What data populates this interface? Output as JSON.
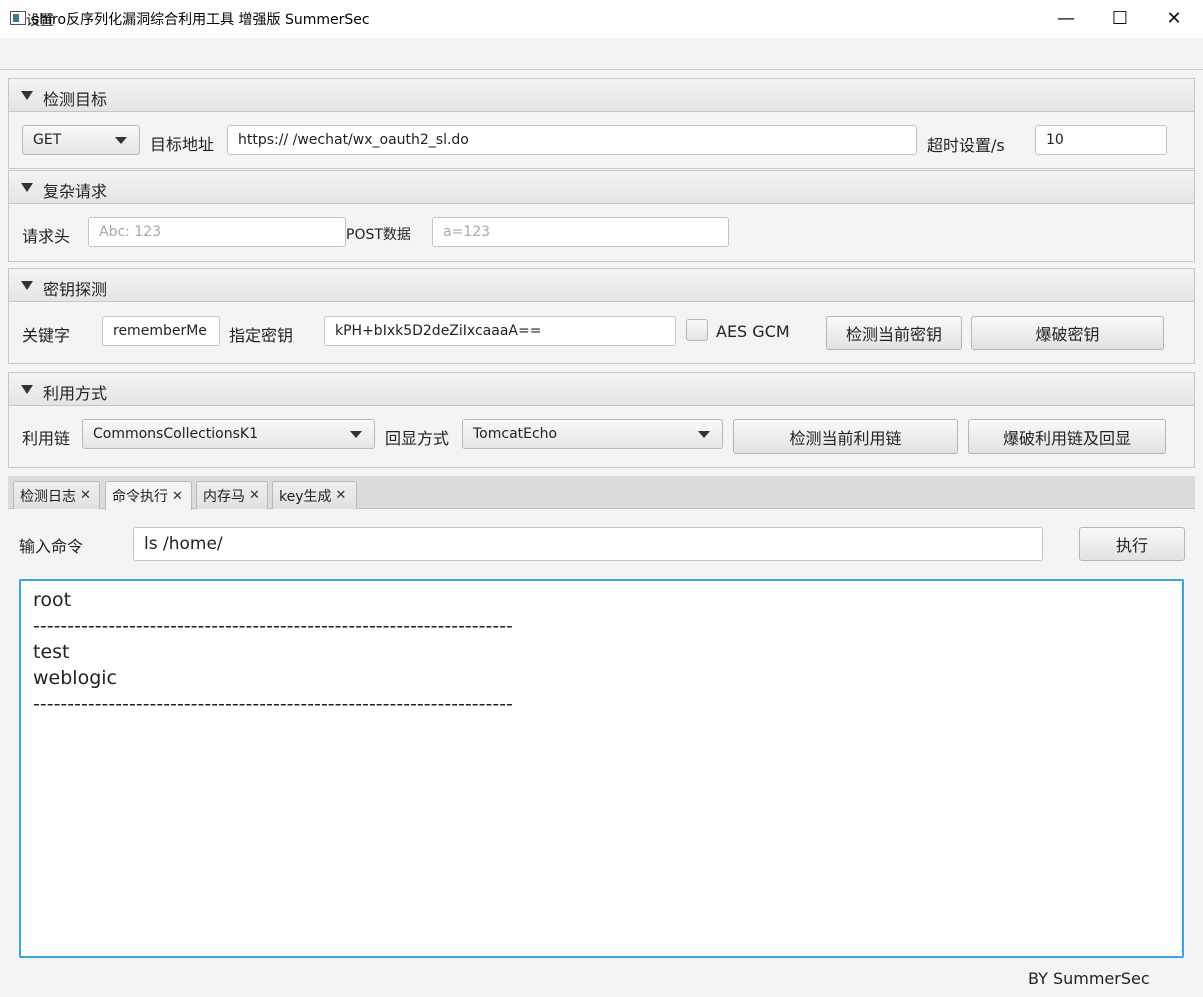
{
  "window": {
    "title": "shiro反序列化漏洞综合利用工具 增强版 SummerSec",
    "minimize": "—",
    "maximize": "☐",
    "close": "✕"
  },
  "menu": {
    "settings": "设置"
  },
  "target": {
    "header": "检测目标",
    "method": "GET",
    "url_label": "目标地址",
    "url_value": "https://                                      /wechat/wx_oauth2_sl.do",
    "timeout_label": "超时设置/s",
    "timeout_value": "10"
  },
  "complex": {
    "header": "复杂请求",
    "headers_label": "请求头",
    "headers_placeholder": "Abc: 123",
    "post_label": "POST数据",
    "post_placeholder": "a=123"
  },
  "key": {
    "header": "密钥探测",
    "keyword_label": "关键字",
    "keyword_value": "rememberMe",
    "key_label": "指定密钥",
    "key_value": "kPH+bIxk5D2deZiIxcaaaA==",
    "aes_gcm_label": "AES GCM",
    "aes_gcm_checked": false,
    "check_key_btn": "检测当前密钥",
    "brute_key_btn": "爆破密钥"
  },
  "exploit": {
    "header": "利用方式",
    "chain_label": "利用链",
    "chain_value": "CommonsCollectionsK1",
    "echo_label": "回显方式",
    "echo_value": "TomcatEcho",
    "check_chain_btn": "检测当前利用链",
    "brute_chain_btn": "爆破利用链及回显"
  },
  "tabs": [
    {
      "label": "检测日志",
      "close": "✕"
    },
    {
      "label": "命令执行",
      "close": "✕",
      "selected": true
    },
    {
      "label": "内存马",
      "close": "✕"
    },
    {
      "label": "key生成",
      "close": "✕"
    }
  ],
  "command": {
    "label": "输入命令",
    "value": "ls /home/",
    "exec_btn": "执行"
  },
  "output": {
    "lines": [
      "root",
      "----------------------------------------------------------------------",
      "test",
      "weblogic",
      "----------------------------------------------------------------------"
    ]
  },
  "footer": {
    "by": "BY    SummerSec"
  },
  "colors": {
    "focus_border": "#3ea3e0"
  }
}
